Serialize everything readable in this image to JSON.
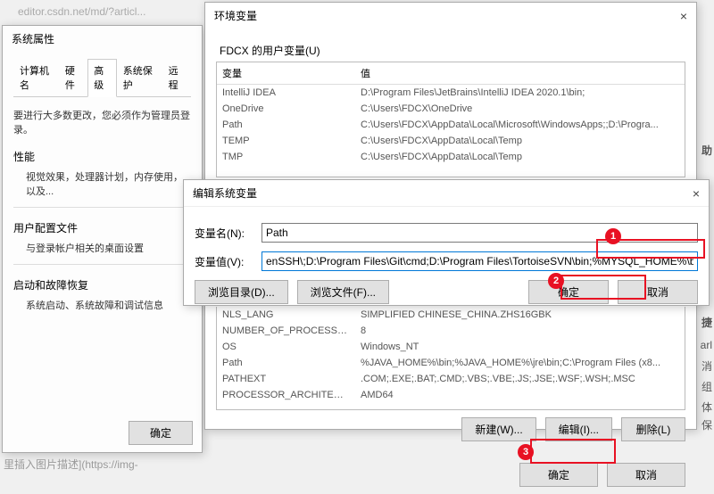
{
  "addr_hint": "editor.csdn.net/md/?articl...",
  "sysprops": {
    "title": "系统属性",
    "tabs": [
      "计算机名",
      "硬件",
      "高级",
      "系统保护",
      "远程"
    ],
    "active_tab": 2,
    "intro": "要进行大多数更改，您必须作为管理员登录。",
    "perf_title": "性能",
    "perf_text": "视觉效果，处理器计划，内存使用，以及...",
    "userprofile_title": "用户配置文件",
    "userprofile_text": "与登录帐户相关的桌面设置",
    "startup_title": "启动和故障恢复",
    "startup_text": "系统启动、系统故障和调试信息",
    "ok": "确定"
  },
  "envvars": {
    "title": "环境变量",
    "user_group": "FDCX 的用户变量(U)",
    "headers": {
      "name": "变量",
      "value": "值"
    },
    "user_rows": [
      {
        "name": "IntelliJ IDEA",
        "value": "D:\\Program Files\\JetBrains\\IntelliJ IDEA 2020.1\\bin;"
      },
      {
        "name": "OneDrive",
        "value": "C:\\Users\\FDCX\\OneDrive"
      },
      {
        "name": "Path",
        "value": "C:\\Users\\FDCX\\AppData\\Local\\Microsoft\\WindowsApps;;D:\\Progra..."
      },
      {
        "name": "TEMP",
        "value": "C:\\Users\\FDCX\\AppData\\Local\\Temp"
      },
      {
        "name": "TMP",
        "value": "C:\\Users\\FDCX\\AppData\\Local\\Temp"
      }
    ],
    "sys_rows": [
      {
        "name": "NLS_LANG",
        "value": "SIMPLIFIED CHINESE_CHINA.ZHS16GBK"
      },
      {
        "name": "NUMBER_OF_PROCESSORS",
        "value": "8"
      },
      {
        "name": "OS",
        "value": "Windows_NT"
      },
      {
        "name": "Path",
        "value": "%JAVA_HOME%\\bin;%JAVA_HOME%\\jre\\bin;C:\\Program Files (x8..."
      },
      {
        "name": "PATHEXT",
        "value": ".COM;.EXE;.BAT;.CMD;.VBS;.VBE;.JS;.JSE;.WSF;.WSH;.MSC"
      },
      {
        "name": "PROCESSOR_ARCHITECTURE",
        "value": "AMD64"
      }
    ],
    "btn_new": "新建(W)...",
    "btn_edit": "编辑(I)...",
    "btn_del": "删除(L)",
    "btn_ok": "确定",
    "btn_cancel": "取消"
  },
  "editvar": {
    "title": "编辑系统变量",
    "name_label": "变量名(N):",
    "name_value": "Path",
    "value_label": "变量值(V):",
    "value_value": "enSSH\\;D:\\Program Files\\Git\\cmd;D:\\Program Files\\TortoiseSVN\\bin;%MYSQL_HOME%\\bin;",
    "browse_dir": "浏览目录(D)...",
    "browse_file": "浏览文件(F)...",
    "ok": "确定",
    "cancel": "取消"
  },
  "callouts": {
    "c1": "1",
    "c2": "2",
    "c3": "3"
  },
  "placeholder": "里插入图片描述](https://img-",
  "side": {
    "help": "助",
    "quick": "捷",
    "a": "arl",
    "x1": "消",
    "x2": "组",
    "x3": "体",
    "x4": "保"
  }
}
